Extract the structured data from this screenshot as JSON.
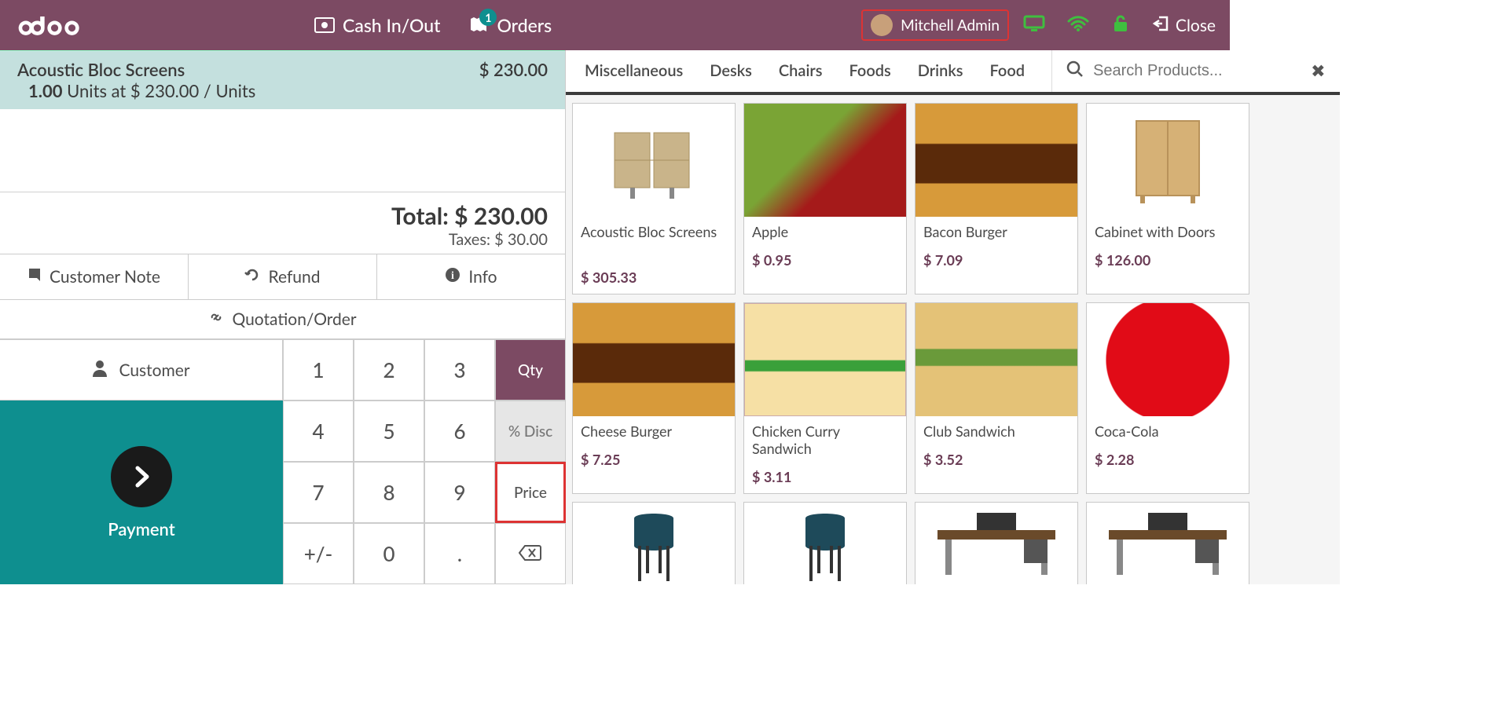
{
  "header": {
    "cash_label": "Cash In/Out",
    "orders_label": "Orders",
    "orders_badge": "1",
    "user_name": "Mitchell Admin",
    "close_label": "Close"
  },
  "order": {
    "line_name": "Acoustic Bloc Screens",
    "line_total": "$ 230.00",
    "qty": "1.00",
    "unit_price_text": "Units at $ 230.00 / Units",
    "total_label": "Total: $ 230.00",
    "taxes_label": "Taxes: $ 30.00"
  },
  "actions": {
    "note": "Customer Note",
    "refund": "Refund",
    "info": "Info",
    "quote": "Quotation/Order"
  },
  "bottom": {
    "customer": "Customer",
    "payment": "Payment",
    "keys": {
      "1": "1",
      "2": "2",
      "3": "3",
      "4": "4",
      "5": "5",
      "6": "6",
      "7": "7",
      "8": "8",
      "9": "9",
      "pm": "+/-",
      "0": "0",
      "dot": "."
    },
    "modes": {
      "qty": "Qty",
      "disc": "% Disc",
      "price": "Price"
    }
  },
  "categories": [
    "Miscellaneous",
    "Desks",
    "Chairs",
    "Foods",
    "Drinks",
    "Food"
  ],
  "search": {
    "placeholder": "Search Products..."
  },
  "products": [
    {
      "name": "Acoustic Bloc Screens",
      "price": "$ 305.33",
      "img": "screen"
    },
    {
      "name": "Apple",
      "price": "$ 0.95",
      "img": "apple"
    },
    {
      "name": "Bacon Burger",
      "price": "$ 7.09",
      "img": "burger"
    },
    {
      "name": "Cabinet with Doors",
      "price": "$ 126.00",
      "img": "cabinet"
    },
    {
      "name": "Cheese Burger",
      "price": "$ 7.25",
      "img": "burger"
    },
    {
      "name": "Chicken Curry Sandwich",
      "price": "$ 3.11",
      "img": "sandwich"
    },
    {
      "name": "Club Sandwich",
      "price": "$ 3.52",
      "img": "club"
    },
    {
      "name": "Coca-Cola",
      "price": "$ 2.28",
      "img": "coke"
    },
    {
      "name": "",
      "price": "",
      "img": "chair",
      "partial": true
    },
    {
      "name": "",
      "price": "",
      "img": "chair",
      "partial": true
    },
    {
      "name": "",
      "price": "",
      "img": "desk",
      "partial": true
    },
    {
      "name": "",
      "price": "",
      "img": "desk",
      "partial": true
    }
  ]
}
